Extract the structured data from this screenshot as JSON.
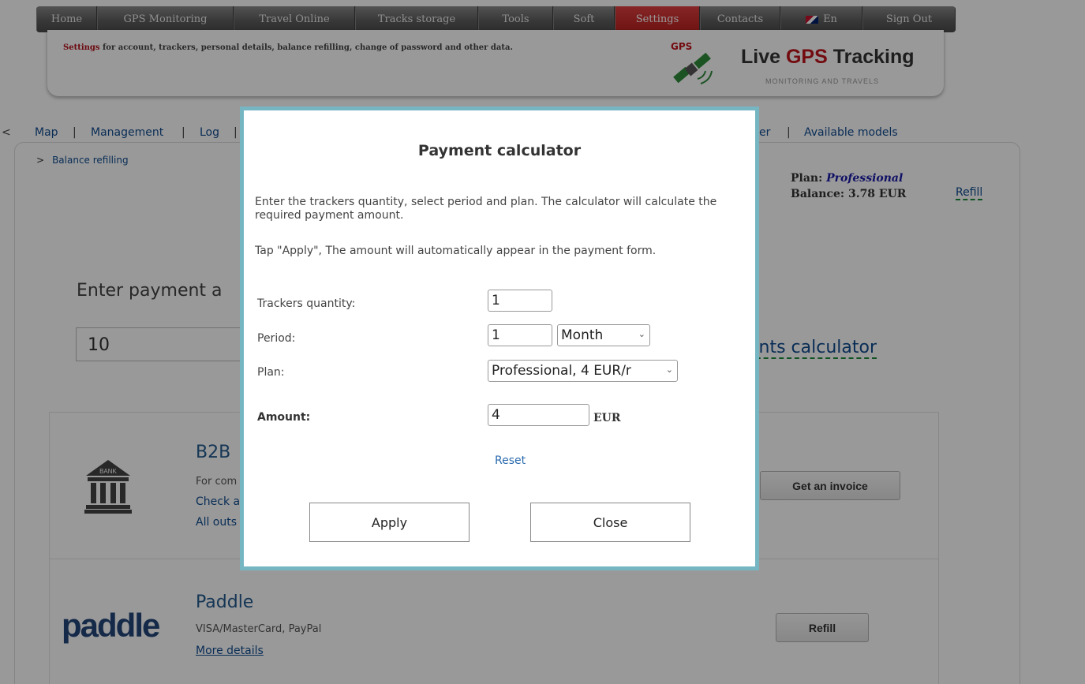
{
  "nav": {
    "items": [
      {
        "label": "Home",
        "w": 77
      },
      {
        "label": "GPS Monitoring",
        "w": 173
      },
      {
        "label": "Travel Online",
        "w": 154
      },
      {
        "label": "Tracks storage",
        "w": 156
      },
      {
        "label": "Tools",
        "w": 95
      },
      {
        "label": "Soft",
        "w": 78
      },
      {
        "label": "Settings",
        "w": 108,
        "active": true
      },
      {
        "label": "Contacts",
        "w": 102
      },
      {
        "label": "En",
        "w": 104,
        "flag": true
      },
      {
        "label": "Sign Out",
        "w": 118
      }
    ]
  },
  "header": {
    "settings_word": "Settings",
    "settings_text": " for account, trackers, personal details, balance refilling, change of password and other data.",
    "logo_gps_small": "GPS",
    "logo_live": "Live ",
    "logo_gps": "GPS",
    "logo_tracking": " Tracking",
    "logo_sub": "MONITORING AND TRAVELS"
  },
  "subnav": {
    "prev": "<",
    "map": "Map",
    "sep": "|",
    "management": "Management",
    "log": "Log",
    "tail_partial": "er",
    "available_models": "Available models"
  },
  "breadcrumb": {
    "arrow": ">",
    "label": "Balance refilling"
  },
  "account": {
    "plan_label": "Plan:",
    "plan_value": "Professional",
    "balance_label": "Balance:",
    "balance_value": "3.78 EUR",
    "refill_link": "Refill"
  },
  "payment": {
    "label": "Enter payment a",
    "amount": "10",
    "calculator_link": "ents calculator"
  },
  "methods": {
    "b2b": {
      "title": "B2B",
      "line1": "For com",
      "line2": "Check a",
      "line3": "All outs",
      "button": "Get an invoice",
      "icon_text": "BANK"
    },
    "paddle": {
      "logo": "paddle",
      "title": "Paddle",
      "desc": "VISA/MasterCard, PayPal",
      "more": "More details",
      "button": "Refill"
    }
  },
  "modal": {
    "title": "Payment calculator",
    "desc": "Enter the trackers quantity, select period and plan. The calculator will calculate the required payment amount.",
    "note": "Tap \"Apply\", The amount will automatically appear in the payment form.",
    "trackers_label": "Trackers quantity:",
    "trackers_value": "1",
    "period_label": "Period:",
    "period_value": "1",
    "period_unit": "Month",
    "plan_label": "Plan:",
    "plan_value": "Professional, 4 EUR/r",
    "amount_label": "Amount:",
    "amount_value": "4",
    "currency": "EUR",
    "reset": "Reset",
    "apply": "Apply",
    "close": "Close"
  },
  "colors": {
    "accent": "#76b6c3",
    "nav_active": "#c9302c",
    "link": "#0f4b8f",
    "brand_red": "#c0151d"
  }
}
